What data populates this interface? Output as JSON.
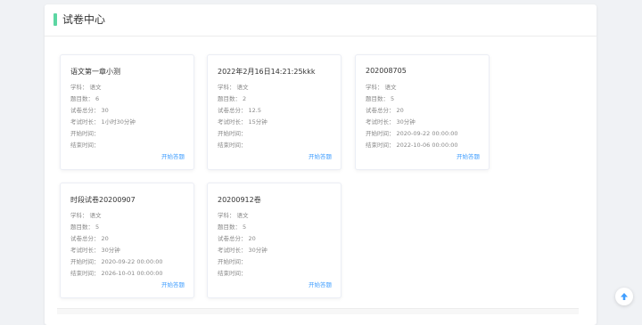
{
  "page": {
    "title": "试卷中心"
  },
  "labels": {
    "subject": "学科：",
    "question_count": "题目数：",
    "total_score": "试卷总分：",
    "duration": "考试时长：",
    "start_time": "开始时间：",
    "end_time": "结束时间：",
    "start_button": "开始答题"
  },
  "cards": [
    {
      "title": "语文第一章小测",
      "subject": "语文",
      "question_count": "6",
      "total_score": "30",
      "duration": "1小时30分钟",
      "start_time": "",
      "end_time": ""
    },
    {
      "title": "2022年2月16日14:21:25kkk",
      "subject": "语文",
      "question_count": "2",
      "total_score": "12.5",
      "duration": "15分钟",
      "start_time": "",
      "end_time": ""
    },
    {
      "title": "202008705",
      "subject": "语文",
      "question_count": "5",
      "total_score": "20",
      "duration": "30分钟",
      "start_time": "2020-09-22 00:00:00",
      "end_time": "2022-10-06 00:00:00"
    },
    {
      "title": "时段试卷20200907",
      "subject": "语文",
      "question_count": "5",
      "total_score": "20",
      "duration": "30分钟",
      "start_time": "2020-09-22 00:00:00",
      "end_time": "2026-10-01 00:00:00"
    },
    {
      "title": "20200912卷",
      "subject": "语文",
      "question_count": "5",
      "total_score": "20",
      "duration": "30分钟",
      "start_time": "",
      "end_time": ""
    }
  ]
}
